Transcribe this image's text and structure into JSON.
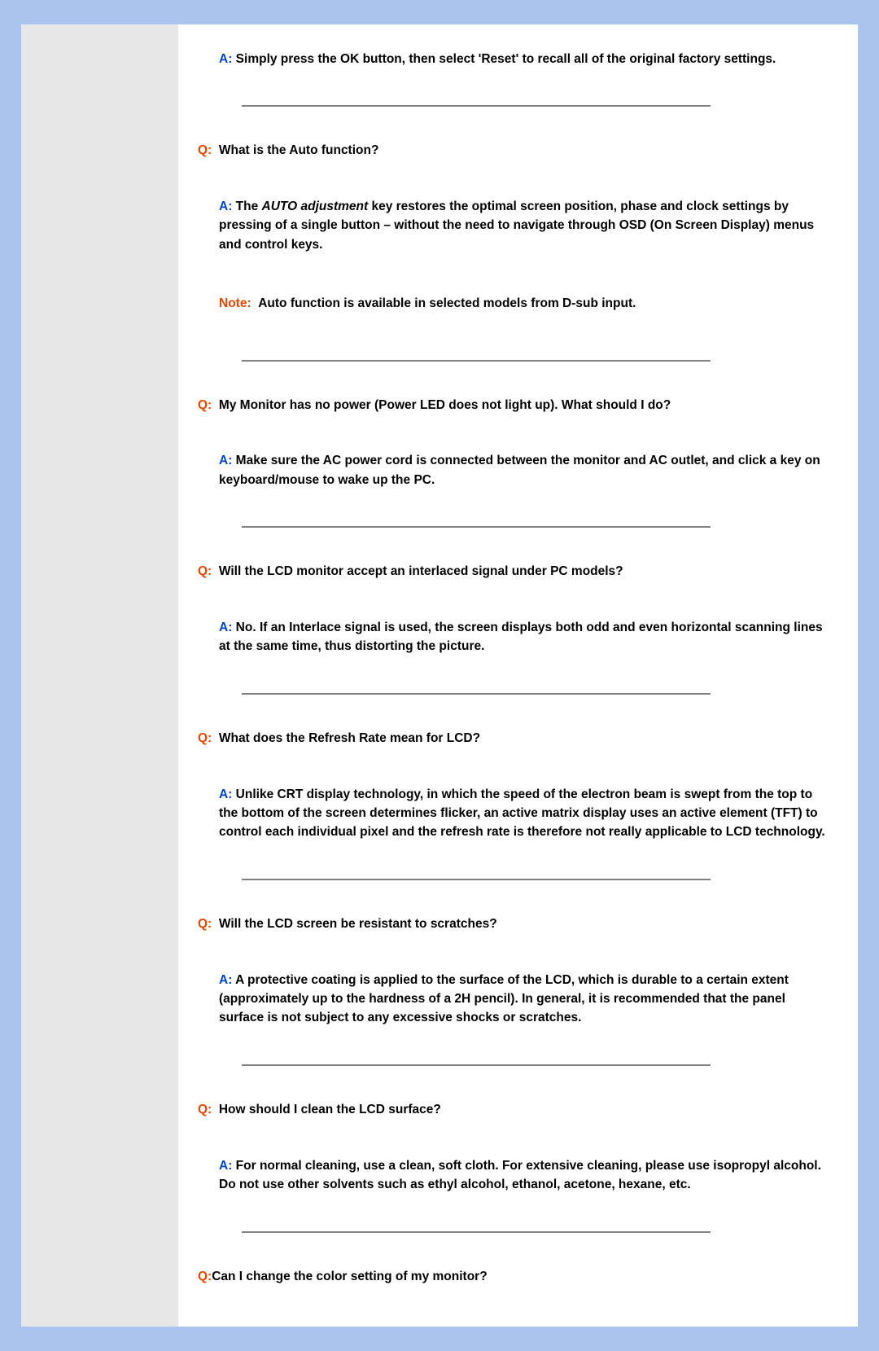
{
  "labels": {
    "q": "Q:",
    "a": "A:",
    "note": "Note:"
  },
  "faq": [
    {
      "q": "",
      "a": "Simply press the OK button, then select 'Reset' to recall all of the original factory settings."
    },
    {
      "q": "What is the Auto function?",
      "a_pre": "The ",
      "a_ital": "AUTO adjustment",
      "a_post": " key restores the optimal screen position, phase and clock settings by pressing of a single button – without the need to navigate through OSD (On Screen Display) menus and control keys.",
      "note": "Auto function is available in selected models from D-sub input."
    },
    {
      "q": "My Monitor has no power (Power LED does not light up). What should I do?",
      "a": "Make sure the AC power cord is connected between the monitor and AC outlet, and click a key on keyboard/mouse to wake up the PC."
    },
    {
      "q": "Will the LCD monitor accept an interlaced signal under PC models?",
      "a": "No. If an Interlace signal is used, the screen displays both odd and even horizontal scanning lines at the same time, thus distorting the picture."
    },
    {
      "q": "What does the Refresh Rate mean for LCD?",
      "a": "Unlike CRT display technology, in which the speed of the electron beam is swept from the top to the bottom of the screen determines flicker, an active matrix display uses an active element (TFT) to control each individual pixel and the refresh rate is therefore not really applicable to LCD technology."
    },
    {
      "q": "Will the LCD screen be resistant to scratches?",
      "a": "A protective coating is applied to the surface of the LCD, which is durable to a certain extent (approximately up to the hardness of a 2H pencil). In general, it is recommended that the panel surface is not subject to any excessive shocks or scratches."
    },
    {
      "q": "How should I clean the LCD surface?",
      "a": "For normal cleaning, use a clean, soft cloth. For extensive cleaning, please use isopropyl alcohol. Do not use other solvents such as ethyl alcohol, ethanol, acetone, hexane, etc."
    },
    {
      "q": "Can I change the color setting of my monitor?",
      "a": ""
    }
  ]
}
